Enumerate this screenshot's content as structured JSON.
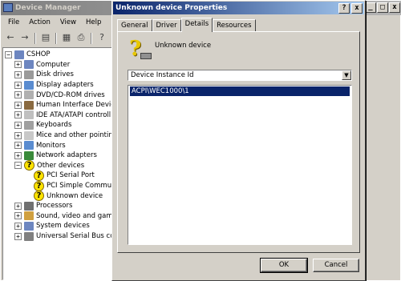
{
  "device_manager": {
    "title": "Device Manager",
    "menu": [
      "File",
      "Action",
      "View",
      "Help"
    ],
    "toolbar_icons": [
      "back-arrow-icon",
      "forward-arrow-icon",
      "show-hide-tree-icon",
      "properties-icon",
      "print-icon",
      "help-icon"
    ],
    "tree": [
      {
        "label": "CSHOP",
        "depth": 0,
        "expander": "−",
        "icon": "computer-icon",
        "color": "#6d86c0"
      },
      {
        "label": "Computer",
        "depth": 1,
        "expander": "+",
        "icon": "computer-icon",
        "color": "#6d86c0"
      },
      {
        "label": "Disk drives",
        "depth": 1,
        "expander": "+",
        "icon": "disk-drive-icon",
        "color": "#9a9a9a"
      },
      {
        "label": "Display adapters",
        "depth": 1,
        "expander": "+",
        "icon": "display-adapter-icon",
        "color": "#5a8cd0"
      },
      {
        "label": "DVD/CD-ROM drives",
        "depth": 1,
        "expander": "+",
        "icon": "cdrom-icon",
        "color": "#b0b0b0"
      },
      {
        "label": "Human Interface Device",
        "depth": 1,
        "expander": "+",
        "icon": "hid-icon",
        "color": "#8a6a40"
      },
      {
        "label": "IDE ATA/ATAPI controll",
        "depth": 1,
        "expander": "+",
        "icon": "ide-controller-icon",
        "color": "#c0c0c0"
      },
      {
        "label": "Keyboards",
        "depth": 1,
        "expander": "+",
        "icon": "keyboard-icon",
        "color": "#a0a0a0"
      },
      {
        "label": "Mice and other pointing",
        "depth": 1,
        "expander": "+",
        "icon": "mouse-icon",
        "color": "#c8c8c8"
      },
      {
        "label": "Monitors",
        "depth": 1,
        "expander": "+",
        "icon": "monitor-icon",
        "color": "#5a8cd0"
      },
      {
        "label": "Network adapters",
        "depth": 1,
        "expander": "+",
        "icon": "network-adapter-icon",
        "color": "#3a8a3a"
      },
      {
        "label": "Other devices",
        "depth": 1,
        "expander": "−",
        "icon": "warning-device-icon",
        "color": "#ffe400",
        "warn": true
      },
      {
        "label": "PCI Serial Port",
        "depth": 2,
        "expander": "",
        "icon": "warning-device-icon",
        "color": "#ffe400",
        "warn": true
      },
      {
        "label": "PCI Simple Commun",
        "depth": 2,
        "expander": "",
        "icon": "warning-device-icon",
        "color": "#ffe400",
        "warn": true
      },
      {
        "label": "Unknown device",
        "depth": 2,
        "expander": "",
        "icon": "warning-device-icon",
        "color": "#ffe400",
        "warn": true
      },
      {
        "label": "Processors",
        "depth": 1,
        "expander": "+",
        "icon": "processor-icon",
        "color": "#707070"
      },
      {
        "label": "Sound, video and game",
        "depth": 1,
        "expander": "+",
        "icon": "sound-icon",
        "color": "#d0a040"
      },
      {
        "label": "System devices",
        "depth": 1,
        "expander": "+",
        "icon": "system-device-icon",
        "color": "#6d86c0"
      },
      {
        "label": "Universal Serial Bus con",
        "depth": 1,
        "expander": "+",
        "icon": "usb-icon",
        "color": "#808080"
      }
    ]
  },
  "dialog": {
    "title": "Unknown device Properties",
    "tabs": [
      "General",
      "Driver",
      "Details",
      "Resources"
    ],
    "active_tab": "Details",
    "device_name": "Unknown device",
    "property_selected": "Device Instance Id",
    "value": "ACPI\\WEC1000\\1",
    "ok_label": "OK",
    "cancel_label": "Cancel"
  },
  "caption_glyphs": {
    "help": "?",
    "close": "x",
    "minimize": "_",
    "maximize": "□"
  }
}
